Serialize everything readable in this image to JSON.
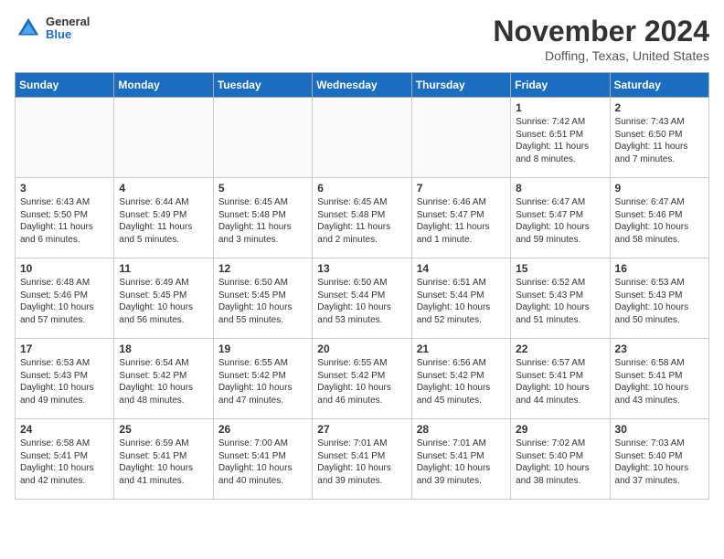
{
  "logo": {
    "general": "General",
    "blue": "Blue"
  },
  "header": {
    "month": "November 2024",
    "location": "Doffing, Texas, United States"
  },
  "days_of_week": [
    "Sunday",
    "Monday",
    "Tuesday",
    "Wednesday",
    "Thursday",
    "Friday",
    "Saturday"
  ],
  "weeks": [
    [
      {
        "day": "",
        "info": ""
      },
      {
        "day": "",
        "info": ""
      },
      {
        "day": "",
        "info": ""
      },
      {
        "day": "",
        "info": ""
      },
      {
        "day": "",
        "info": ""
      },
      {
        "day": "1",
        "info": "Sunrise: 7:42 AM\nSunset: 6:51 PM\nDaylight: 11 hours and 8 minutes."
      },
      {
        "day": "2",
        "info": "Sunrise: 7:43 AM\nSunset: 6:50 PM\nDaylight: 11 hours and 7 minutes."
      }
    ],
    [
      {
        "day": "3",
        "info": "Sunrise: 6:43 AM\nSunset: 5:50 PM\nDaylight: 11 hours and 6 minutes."
      },
      {
        "day": "4",
        "info": "Sunrise: 6:44 AM\nSunset: 5:49 PM\nDaylight: 11 hours and 5 minutes."
      },
      {
        "day": "5",
        "info": "Sunrise: 6:45 AM\nSunset: 5:48 PM\nDaylight: 11 hours and 3 minutes."
      },
      {
        "day": "6",
        "info": "Sunrise: 6:45 AM\nSunset: 5:48 PM\nDaylight: 11 hours and 2 minutes."
      },
      {
        "day": "7",
        "info": "Sunrise: 6:46 AM\nSunset: 5:47 PM\nDaylight: 11 hours and 1 minute."
      },
      {
        "day": "8",
        "info": "Sunrise: 6:47 AM\nSunset: 5:47 PM\nDaylight: 10 hours and 59 minutes."
      },
      {
        "day": "9",
        "info": "Sunrise: 6:47 AM\nSunset: 5:46 PM\nDaylight: 10 hours and 58 minutes."
      }
    ],
    [
      {
        "day": "10",
        "info": "Sunrise: 6:48 AM\nSunset: 5:46 PM\nDaylight: 10 hours and 57 minutes."
      },
      {
        "day": "11",
        "info": "Sunrise: 6:49 AM\nSunset: 5:45 PM\nDaylight: 10 hours and 56 minutes."
      },
      {
        "day": "12",
        "info": "Sunrise: 6:50 AM\nSunset: 5:45 PM\nDaylight: 10 hours and 55 minutes."
      },
      {
        "day": "13",
        "info": "Sunrise: 6:50 AM\nSunset: 5:44 PM\nDaylight: 10 hours and 53 minutes."
      },
      {
        "day": "14",
        "info": "Sunrise: 6:51 AM\nSunset: 5:44 PM\nDaylight: 10 hours and 52 minutes."
      },
      {
        "day": "15",
        "info": "Sunrise: 6:52 AM\nSunset: 5:43 PM\nDaylight: 10 hours and 51 minutes."
      },
      {
        "day": "16",
        "info": "Sunrise: 6:53 AM\nSunset: 5:43 PM\nDaylight: 10 hours and 50 minutes."
      }
    ],
    [
      {
        "day": "17",
        "info": "Sunrise: 6:53 AM\nSunset: 5:43 PM\nDaylight: 10 hours and 49 minutes."
      },
      {
        "day": "18",
        "info": "Sunrise: 6:54 AM\nSunset: 5:42 PM\nDaylight: 10 hours and 48 minutes."
      },
      {
        "day": "19",
        "info": "Sunrise: 6:55 AM\nSunset: 5:42 PM\nDaylight: 10 hours and 47 minutes."
      },
      {
        "day": "20",
        "info": "Sunrise: 6:55 AM\nSunset: 5:42 PM\nDaylight: 10 hours and 46 minutes."
      },
      {
        "day": "21",
        "info": "Sunrise: 6:56 AM\nSunset: 5:42 PM\nDaylight: 10 hours and 45 minutes."
      },
      {
        "day": "22",
        "info": "Sunrise: 6:57 AM\nSunset: 5:41 PM\nDaylight: 10 hours and 44 minutes."
      },
      {
        "day": "23",
        "info": "Sunrise: 6:58 AM\nSunset: 5:41 PM\nDaylight: 10 hours and 43 minutes."
      }
    ],
    [
      {
        "day": "24",
        "info": "Sunrise: 6:58 AM\nSunset: 5:41 PM\nDaylight: 10 hours and 42 minutes."
      },
      {
        "day": "25",
        "info": "Sunrise: 6:59 AM\nSunset: 5:41 PM\nDaylight: 10 hours and 41 minutes."
      },
      {
        "day": "26",
        "info": "Sunrise: 7:00 AM\nSunset: 5:41 PM\nDaylight: 10 hours and 40 minutes."
      },
      {
        "day": "27",
        "info": "Sunrise: 7:01 AM\nSunset: 5:41 PM\nDaylight: 10 hours and 39 minutes."
      },
      {
        "day": "28",
        "info": "Sunrise: 7:01 AM\nSunset: 5:41 PM\nDaylight: 10 hours and 39 minutes."
      },
      {
        "day": "29",
        "info": "Sunrise: 7:02 AM\nSunset: 5:40 PM\nDaylight: 10 hours and 38 minutes."
      },
      {
        "day": "30",
        "info": "Sunrise: 7:03 AM\nSunset: 5:40 PM\nDaylight: 10 hours and 37 minutes."
      }
    ]
  ]
}
